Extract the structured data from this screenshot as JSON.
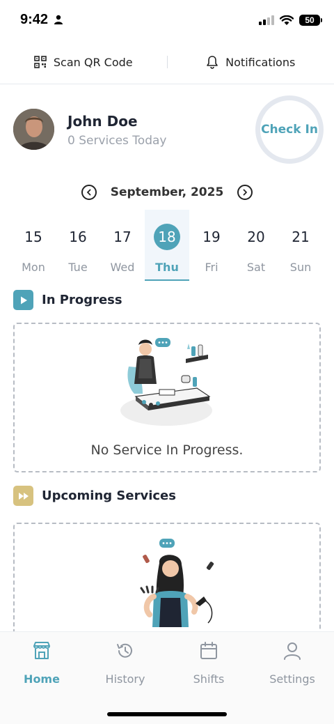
{
  "status_bar": {
    "time": "9:42",
    "battery": "50"
  },
  "top_actions": {
    "scan_label": "Scan QR Code",
    "notifications_label": "Notifications"
  },
  "profile": {
    "name": "John Doe",
    "subtitle": "0 Services Today",
    "check_in_label": "Check In"
  },
  "calendar": {
    "month_label": "September, 2025",
    "days": [
      {
        "num": "15",
        "name": "Mon"
      },
      {
        "num": "16",
        "name": "Tue"
      },
      {
        "num": "17",
        "name": "Wed"
      },
      {
        "num": "18",
        "name": "Thu",
        "selected": true
      },
      {
        "num": "19",
        "name": "Fri"
      },
      {
        "num": "20",
        "name": "Sat"
      },
      {
        "num": "21",
        "name": "Sun"
      }
    ]
  },
  "in_progress": {
    "title": "In Progress",
    "empty_text": "No Service In Progress."
  },
  "upcoming": {
    "title": "Upcoming Services"
  },
  "bottom_nav": {
    "items": [
      {
        "label": "Home",
        "icon": "store-icon",
        "active": true
      },
      {
        "label": "History",
        "icon": "history-icon"
      },
      {
        "label": "Shifts",
        "icon": "calendar-icon"
      },
      {
        "label": "Settings",
        "icon": "user-icon"
      }
    ]
  },
  "colors": {
    "accent": "#4fa3b8",
    "upcoming_icon": "#d7c27f",
    "text_dark": "#1f2533",
    "text_muted": "#8f96a0"
  }
}
